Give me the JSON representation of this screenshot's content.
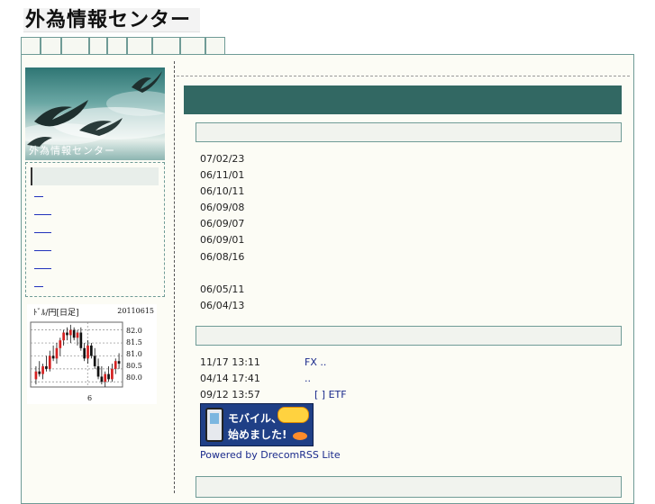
{
  "site": {
    "logo_text": "外為情報センター",
    "banner_text": "外為情報センター"
  },
  "tabs": [
    {
      "label": ""
    },
    {
      "label": ""
    },
    {
      "label": ""
    },
    {
      "label": ""
    },
    {
      "label": ""
    },
    {
      "label": ""
    },
    {
      "label": ""
    },
    {
      "label": ""
    },
    {
      "label": ""
    }
  ],
  "sidebar": {
    "menu_header": "",
    "links": [
      {
        "label": ""
      },
      {
        "label": ""
      },
      {
        "label": ""
      },
      {
        "label": ""
      },
      {
        "label": ""
      },
      {
        "label": ""
      }
    ]
  },
  "fx_chart": {
    "title": "ﾄﾞﾙ/円[日足]",
    "date": "20110615",
    "y_ticks": [
      "82.0",
      "81.5",
      "81.0",
      "80.5",
      "80.0"
    ],
    "x_tick": "6",
    "ylim": [
      79.8,
      82.3
    ],
    "candles": [
      {
        "o": 80.1,
        "h": 80.6,
        "l": 79.9,
        "c": 80.4
      },
      {
        "o": 80.4,
        "h": 80.8,
        "l": 80.2,
        "c": 80.3
      },
      {
        "o": 80.3,
        "h": 80.7,
        "l": 80.1,
        "c": 80.6
      },
      {
        "o": 80.6,
        "h": 81.0,
        "l": 80.4,
        "c": 80.5
      },
      {
        "o": 80.5,
        "h": 81.2,
        "l": 80.4,
        "c": 81.0
      },
      {
        "o": 81.0,
        "h": 81.4,
        "l": 80.8,
        "c": 80.9
      },
      {
        "o": 80.9,
        "h": 81.5,
        "l": 80.7,
        "c": 81.3
      },
      {
        "o": 81.3,
        "h": 81.7,
        "l": 81.0,
        "c": 81.6
      },
      {
        "o": 81.6,
        "h": 82.0,
        "l": 81.4,
        "c": 81.9
      },
      {
        "o": 81.9,
        "h": 82.1,
        "l": 81.6,
        "c": 81.8
      },
      {
        "o": 81.8,
        "h": 82.2,
        "l": 81.5,
        "c": 82.0
      },
      {
        "o": 82.0,
        "h": 82.1,
        "l": 81.6,
        "c": 81.7
      },
      {
        "o": 81.7,
        "h": 82.0,
        "l": 81.4,
        "c": 81.9
      },
      {
        "o": 81.9,
        "h": 82.1,
        "l": 81.2,
        "c": 81.3
      },
      {
        "o": 81.3,
        "h": 81.5,
        "l": 80.8,
        "c": 80.9
      },
      {
        "o": 80.9,
        "h": 81.6,
        "l": 80.7,
        "c": 81.4
      },
      {
        "o": 81.4,
        "h": 81.5,
        "l": 80.9,
        "c": 81.0
      },
      {
        "o": 81.0,
        "h": 81.3,
        "l": 80.5,
        "c": 80.6
      },
      {
        "o": 80.6,
        "h": 80.9,
        "l": 80.1,
        "c": 80.2
      },
      {
        "o": 80.2,
        "h": 80.6,
        "l": 79.9,
        "c": 80.0
      },
      {
        "o": 80.0,
        "h": 80.4,
        "l": 79.8,
        "c": 80.3
      },
      {
        "o": 80.3,
        "h": 80.6,
        "l": 80.0,
        "c": 80.1
      },
      {
        "o": 80.1,
        "h": 80.7,
        "l": 80.0,
        "c": 80.5
      },
      {
        "o": 80.5,
        "h": 80.9,
        "l": 80.3,
        "c": 80.8
      },
      {
        "o": 80.8,
        "h": 81.1,
        "l": 80.5,
        "c": 80.7
      }
    ],
    "up_color": "#d42020",
    "down_color": "#111111"
  },
  "main": {
    "title": "",
    "section1_title": "",
    "dates": [
      "07/02/23",
      "06/11/01",
      "06/10/11",
      "06/09/08",
      "06/09/07",
      "06/09/01",
      "06/08/16",
      "",
      "06/05/11",
      "06/04/13"
    ],
    "section2_title": "",
    "rss_items": [
      {
        "time": "11/17 13:11",
        "text": "FX                    .."
      },
      {
        "time": "04/14 17:41",
        "text": "                          .."
      },
      {
        "time": "09/12 13:57",
        "text": "[     ]      ETF"
      }
    ],
    "mobile_banner": {
      "line1": "モバイル、",
      "line2": "始めました!"
    },
    "powered_by": "Powered by DrecomRSS Lite"
  },
  "colors": {
    "accent": "#326863",
    "border": "#6f9b96",
    "link": "#1a2a8c"
  }
}
